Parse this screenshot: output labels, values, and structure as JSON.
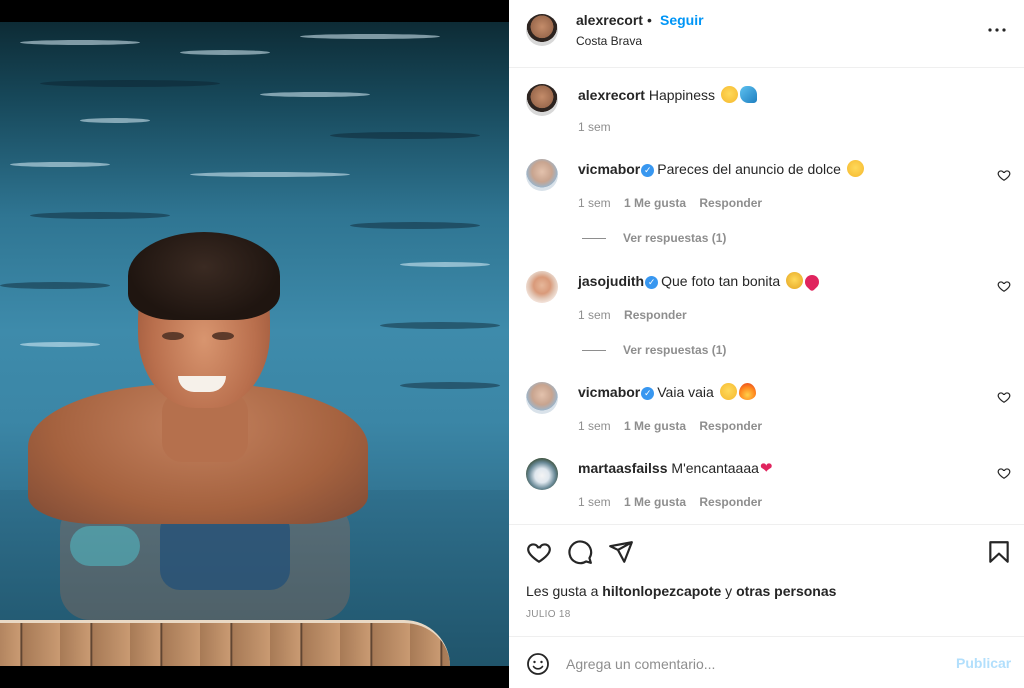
{
  "post": {
    "username": "alexrecort",
    "separator": "•",
    "follow_label": "Seguir",
    "location": "Costa Brava",
    "more_icon": "more-horizontal-icon",
    "caption": {
      "username": "alexrecort",
      "text": "Happiness",
      "emojis": [
        "grinning-face-emoji",
        "water-wave-emoji"
      ],
      "time": "1 sem"
    }
  },
  "comments": [
    {
      "username": "vicmabor",
      "verified": true,
      "text": "Pareces del anuncio de dolce",
      "emojis": [
        "laughing-face-emoji"
      ],
      "time": "1 sem",
      "likes": "1 Me gusta",
      "reply": "Responder",
      "view_replies": "Ver respuestas (1)"
    },
    {
      "username": "jasojudith",
      "verified": true,
      "text": "Que foto tan bonita",
      "emojis": [
        "pleading-face-emoji",
        "broken-heart-emoji"
      ],
      "time": "1 sem",
      "likes": "",
      "reply": "Responder",
      "view_replies": "Ver respuestas (1)"
    },
    {
      "username": "vicmabor",
      "verified": true,
      "text": "Vaia vaia",
      "emojis": [
        "heart-eyes-emoji",
        "fire-emoji"
      ],
      "time": "1 sem",
      "likes": "1 Me gusta",
      "reply": "Responder"
    },
    {
      "username": "martaasfailss",
      "verified": false,
      "text": "M'encantaaaa",
      "emojis": [
        "red-heart-emoji"
      ],
      "time": "1 sem",
      "likes": "1 Me gusta",
      "reply": "Responder"
    }
  ],
  "actions": {
    "like_icon": "heart-icon",
    "comment_icon": "comment-icon",
    "share_icon": "paper-plane-icon",
    "save_icon": "bookmark-icon",
    "liked_by_prefix": "Les gusta a",
    "liked_by_user": "hiltonlopezcapote",
    "liked_by_middle": "y",
    "liked_by_suffix": "otras personas",
    "date": "JULIO 18"
  },
  "composer": {
    "emoji_icon": "smiley-icon",
    "placeholder": "Agrega un comentario...",
    "publish_label": "Publicar"
  },
  "colors": {
    "link_blue": "#0095f6",
    "publish_disabled": "#b2dffc",
    "verified_blue": "#3897f0",
    "secondary_text": "#8e8e8e"
  }
}
